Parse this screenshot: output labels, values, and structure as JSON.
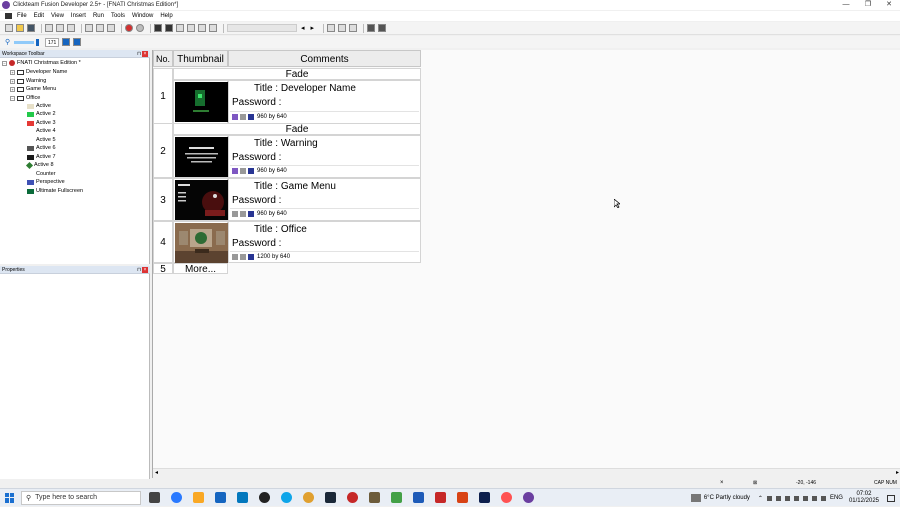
{
  "window": {
    "title": "Clickteam Fusion Developer 2.5+ - [FNATI Christmas Edition*]",
    "minimize": "—",
    "restore": "❐",
    "close": "✕"
  },
  "menu": [
    "File",
    "Edit",
    "View",
    "Insert",
    "Run",
    "Tools",
    "Window",
    "Help"
  ],
  "toolbar2": {
    "zoom_value": "171"
  },
  "workspace": {
    "header": "Workspace Toolbar",
    "root": "FNATI Christmas Edition *",
    "frames": [
      "Developer Name",
      "Warning",
      "Game Menu",
      "Office"
    ],
    "office_objects": [
      {
        "label": "Active",
        "color": "#e7e0c8"
      },
      {
        "label": "Active 2",
        "color": "#22c94a"
      },
      {
        "label": "Active 3",
        "color": "#e53935"
      },
      {
        "label": "Active 4",
        "color": ""
      },
      {
        "label": "Active 5",
        "color": ""
      },
      {
        "label": "Active 6",
        "color": "#555555"
      },
      {
        "label": "Active 7",
        "color": "#1a1a1a"
      },
      {
        "label": "Active 8",
        "color": "#2e7d32"
      },
      {
        "label": "Counter",
        "color": ""
      },
      {
        "label": "Perspective",
        "color": "#3f51b5"
      },
      {
        "label": "Ultimate Fullscreen",
        "color": "#0b6b3a"
      }
    ]
  },
  "properties": {
    "header": "Properties"
  },
  "storyboard": {
    "col_no": "No.",
    "col_thumb": "Thumbnail",
    "col_comments": "Comments",
    "rows": [
      {
        "no": "1",
        "fade_top": "Fade",
        "title": "Title : Developer Name",
        "password": "Password :",
        "res": "960  by 640",
        "thumb": "dev"
      },
      {
        "no": "2",
        "fade_top": "Fade",
        "title": "Title : Warning",
        "password": "Password :",
        "res": "960  by 640",
        "thumb": "warn"
      },
      {
        "no": "3",
        "fade_top": "",
        "title": "Title : Game Menu",
        "password": "Password :",
        "res": "960  by 640",
        "thumb": "menu"
      },
      {
        "no": "4",
        "fade_top": "",
        "title": "Title : Office",
        "password": "Password :",
        "res": "1200 by 640",
        "thumb": "office"
      }
    ],
    "more_no": "5",
    "more_label": "More..."
  },
  "statusbar": {
    "coords": "-20, -146",
    "caps": "CAP NUM"
  },
  "taskbar": {
    "search_placeholder": "Type here to search",
    "weather": "6°C  Partly cloudy",
    "lang": "ENG",
    "time": "07:02",
    "date": "01/12/2025"
  }
}
